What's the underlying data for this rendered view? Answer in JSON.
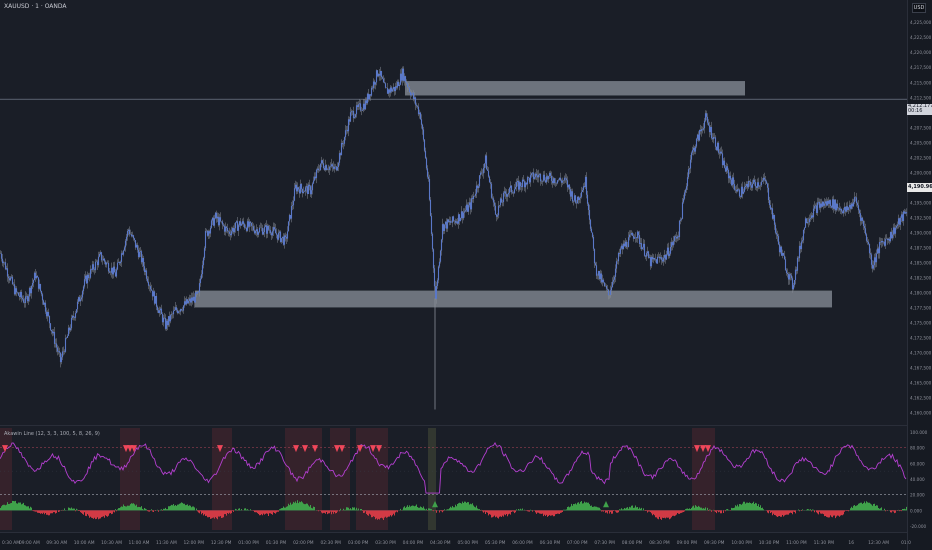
{
  "header": {
    "symbol": "XAUUSD · 1 · OANDA",
    "currency": "USD"
  },
  "indicator": {
    "label": "Akawin Line (12, 3, 3, 100, 5, 8, 26, 9)"
  },
  "price_tags": {
    "line_price": "4,212.177",
    "line_countdown": "00:16",
    "last_price": "4,190.965"
  },
  "colors": {
    "background": "#1a1e27",
    "candle": "#5a78c8",
    "zone": "#8a909b",
    "osc_line": "#b43fd0",
    "hist_up": "#3fa14a",
    "hist_down": "#d23a45",
    "signal_marker": "#f0475a"
  },
  "chart_data": [
    {
      "type": "line",
      "title": "",
      "description_series": "price",
      "y_axis_labels": [
        "4,225,000",
        "4,222,500",
        "4,220,000",
        "4,217,500",
        "4,215,000",
        "4,212,500",
        "4,210,000",
        "4,207,500",
        "4,205,000",
        "4,202,500",
        "4,200,000",
        "4,197,500",
        "4,195,000",
        "4,192,500",
        "4,190,000",
        "4,187,500",
        "4,185,000",
        "4,182,500",
        "4,180,000",
        "4,177,500",
        "4,175,000",
        "4,172,500",
        "4,170,000",
        "4,167,500",
        "4,165,000",
        "4,162,500",
        "4,160,000"
      ],
      "ylim": [
        4158750,
        4227700
      ],
      "x_axis_labels": [
        "0:30 AM",
        "09:00 AM",
        "09:30 AM",
        "10:00 AM",
        "10:30 AM",
        "11:00 AM",
        "11:30 AM",
        "12:00 PM",
        "12:30 PM",
        "01:00 PM",
        "01:30 PM",
        "02:00 PM",
        "02:30 PM",
        "03:00 PM",
        "03:30 PM",
        "04:00 PM",
        "04:30 PM",
        "05:00 PM",
        "05:30 PM",
        "06:00 PM",
        "06:30 PM",
        "07:00 PM",
        "07:30 PM",
        "08:00 PM",
        "08:30 PM",
        "09:00 PM",
        "09:30 PM",
        "10:00 PM",
        "10:30 PM",
        "11:00 PM",
        "11:30 PM",
        "16",
        "12:30 AM",
        "01:0"
      ],
      "price_path": [
        [
          0,
          4186500
        ],
        [
          15,
          4180000
        ],
        [
          25,
          4178500
        ],
        [
          35,
          4183000
        ],
        [
          45,
          4177500
        ],
        [
          60,
          4168500
        ],
        [
          70,
          4174500
        ],
        [
          85,
          4182000
        ],
        [
          100,
          4186000
        ],
        [
          115,
          4183000
        ],
        [
          128,
          4190500
        ],
        [
          140,
          4186000
        ],
        [
          155,
          4178500
        ],
        [
          165,
          4174500
        ],
        [
          175,
          4177000
        ],
        [
          185,
          4178000
        ],
        [
          198,
          4179500
        ],
        [
          205,
          4189500
        ],
        [
          215,
          4192500
        ],
        [
          228,
          4190000
        ],
        [
          240,
          4191500
        ],
        [
          255,
          4190500
        ],
        [
          270,
          4190500
        ],
        [
          285,
          4188500
        ],
        [
          295,
          4197500
        ],
        [
          310,
          4197000
        ],
        [
          320,
          4201500
        ],
        [
          335,
          4200500
        ],
        [
          350,
          4209500
        ],
        [
          365,
          4211500
        ],
        [
          378,
          4217000
        ],
        [
          385,
          4213500
        ],
        [
          395,
          4214000
        ],
        [
          402,
          4216500
        ],
        [
          410,
          4213500
        ],
        [
          420,
          4209500
        ],
        [
          428,
          4198000
        ],
        [
          435,
          4179000
        ],
        [
          442,
          4191000
        ],
        [
          455,
          4192000
        ],
        [
          470,
          4194500
        ],
        [
          485,
          4202000
        ],
        [
          495,
          4193000
        ],
        [
          505,
          4196500
        ],
        [
          520,
          4198000
        ],
        [
          535,
          4199500
        ],
        [
          550,
          4199000
        ],
        [
          565,
          4198500
        ],
        [
          575,
          4195000
        ],
        [
          585,
          4198500
        ],
        [
          595,
          4184000
        ],
        [
          608,
          4179500
        ],
        [
          620,
          4187000
        ],
        [
          635,
          4190000
        ],
        [
          650,
          4185000
        ],
        [
          665,
          4186000
        ],
        [
          678,
          4190000
        ],
        [
          690,
          4202500
        ],
        [
          705,
          4209000
        ],
        [
          715,
          4205000
        ],
        [
          725,
          4200500
        ],
        [
          738,
          4196500
        ],
        [
          750,
          4198000
        ],
        [
          765,
          4198500
        ],
        [
          778,
          4188000
        ],
        [
          792,
          4181000
        ],
        [
          805,
          4192000
        ],
        [
          818,
          4194500
        ],
        [
          830,
          4195000
        ],
        [
          845,
          4193500
        ],
        [
          855,
          4195500
        ],
        [
          865,
          4190000
        ],
        [
          872,
          4184500
        ],
        [
          880,
          4188000
        ],
        [
          890,
          4189500
        ],
        [
          898,
          4191500
        ],
        [
          906,
          4193500
        ]
      ],
      "zones": [
        {
          "x_start": 405,
          "x_end": 745,
          "y_top": 4215200,
          "y_bottom": 4212800
        },
        {
          "x_start": 195,
          "x_end": 832,
          "y_top": 4180300,
          "y_bottom": 4177500
        }
      ],
      "horizontal_line_price": 4212177,
      "wick_low": 4160500,
      "wick_x": 435
    },
    {
      "type": "line",
      "title": "",
      "description_series": "oscillator",
      "y_axis_labels": [
        "100.000",
        "80.000",
        "60.000",
        "40.000",
        "20.000",
        "0.000",
        "-20.000"
      ],
      "ylim": [
        -25,
        105
      ],
      "signal_levels": [
        80,
        20,
        0
      ],
      "sell_markers_x": [
        5,
        126,
        130,
        134,
        220,
        296,
        305,
        315,
        337,
        342,
        360,
        373,
        379,
        697,
        703,
        708
      ]
    }
  ]
}
